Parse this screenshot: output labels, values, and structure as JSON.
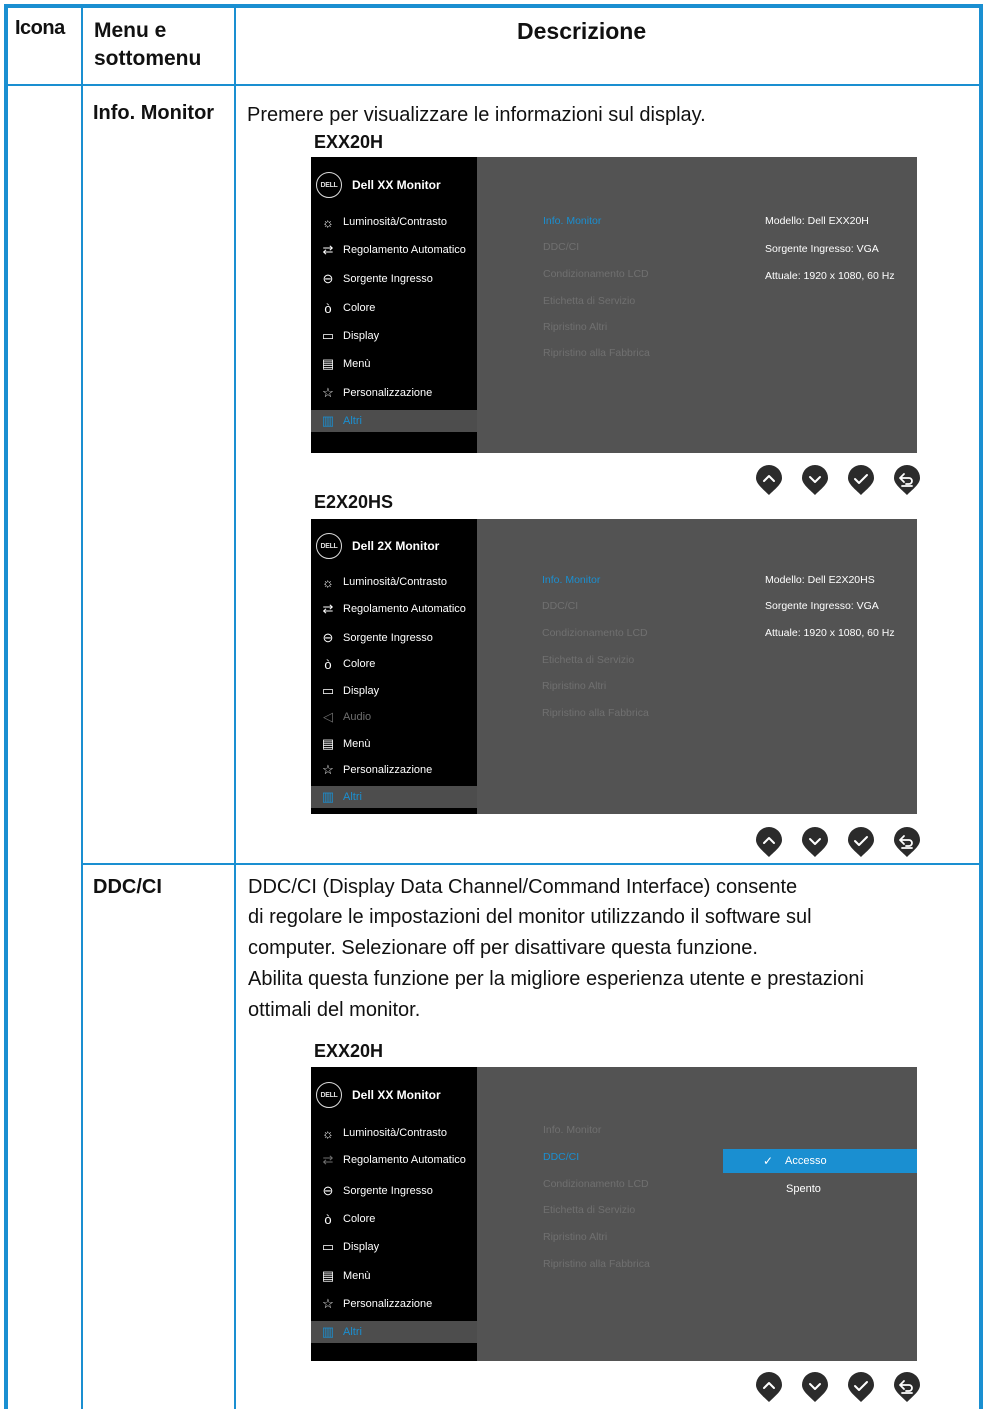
{
  "header": {
    "icon": "Icona",
    "menu": "Menu e sottomenu",
    "desc": "Descrizione"
  },
  "row1": {
    "label": "Info. Monitor",
    "intro": "Premere per visualizzare le informazioni sul display.",
    "model_a": "EXX20H",
    "model_b": "E2X20HS"
  },
  "osd1": {
    "title": "Dell XX Monitor",
    "menu": [
      "Luminosità/Contrasto",
      "Regolamento Automatico",
      "Sorgente Ingresso",
      "Colore",
      "Display",
      "Menù",
      "Personalizzazione",
      "Altri"
    ],
    "sub": [
      "Info. Monitor",
      "DDC/CI",
      "Condizionamento LCD",
      "Etichetta di Servizio",
      "Ripristino Altri",
      "Ripristino alla Fabbrica"
    ],
    "info": [
      "Modello: Dell EXX20H",
      "Sorgente Ingresso: VGA",
      "Attuale: 1920 x 1080, 60 Hz"
    ]
  },
  "osd2": {
    "title": "Dell 2X Monitor",
    "menu": [
      "Luminosità/Contrasto",
      "Regolamento Automatico",
      "Sorgente Ingresso",
      "Colore",
      "Display",
      "Audio",
      "Menù",
      "Personalizzazione",
      "Altri"
    ],
    "sub": [
      "Info. Monitor",
      "DDC/CI",
      "Condizionamento LCD",
      "Etichetta di Servizio",
      "Ripristino Altri",
      "Ripristino alla Fabbrica"
    ],
    "info": [
      "Modello: Dell E2X20HS",
      "Sorgente Ingresso: VGA",
      "Attuale: 1920 x 1080, 60 Hz"
    ]
  },
  "row2": {
    "label": "DDC/CI",
    "lines": [
      "DDC/CI (Display Data Channel/Command Interface) consente",
      "di regolare le impostazioni del monitor utilizzando il software sul",
      "computer. Selezionare off per disattivare questa funzione.",
      "Abilita questa funzione per la migliore esperienza utente e prestazioni",
      "ottimali del monitor."
    ],
    "model_a": "EXX20H"
  },
  "osd3": {
    "title": "Dell XX Monitor",
    "menu": [
      "Luminosità/Contrasto",
      "Regolamento Automatico",
      "Sorgente Ingresso",
      "Colore",
      "Display",
      "Menù",
      "Personalizzazione",
      "Altri"
    ],
    "sub": [
      "Info. Monitor",
      "DDC/CI",
      "Condizionamento LCD",
      "Etichetta di Servizio",
      "Ripristino Altri",
      "Ripristino alla Fabbrica"
    ],
    "options": [
      "Accesso",
      "Spento"
    ]
  },
  "logo_text": "DELL",
  "buttons": [
    "up-button",
    "down-button",
    "ok-button",
    "back-button"
  ],
  "colors": {
    "accent": "#1a8fd1",
    "osd_bg": "#535353",
    "osd_menu_bg": "#000000"
  }
}
